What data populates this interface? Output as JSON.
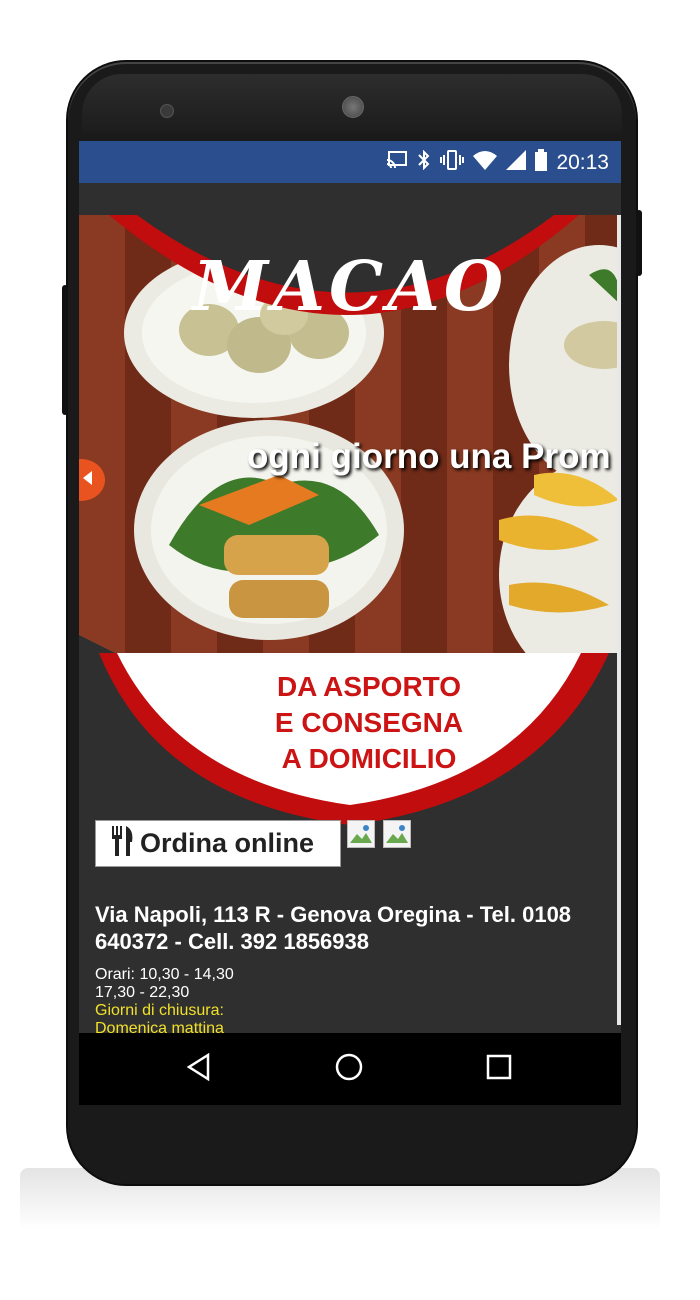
{
  "status_bar": {
    "time": "20:13",
    "icons": [
      "cast-icon",
      "bluetooth-icon",
      "vibrate-icon",
      "wifi-icon",
      "signal-icon",
      "battery-icon"
    ],
    "background": "#2b4f8e"
  },
  "hero": {
    "logo": "MACAO",
    "caption": "ogni giorno una Prom",
    "prev_icon": "chevron-left-icon",
    "accent": "#cc1414"
  },
  "tagline": {
    "line1": "DA ASPORTO",
    "line2": "E CONSEGNA",
    "line3": "A DOMICILIO"
  },
  "order_button": {
    "label": "Ordina online",
    "icon": "fork-knife-icon"
  },
  "address": "Via Napoli, 113 R - Genova Oregina - Tel. 0108 640372 - Cell. 392 1856938",
  "hours": {
    "line1": "Orari: 10,30 - 14,30",
    "line2": "17,30 - 22,30",
    "closing_label": "Giorni di chiusura:",
    "closing_value": "Domenica mattina"
  },
  "nav": {
    "back": "back-icon",
    "home": "home-icon",
    "recents": "recents-icon"
  }
}
